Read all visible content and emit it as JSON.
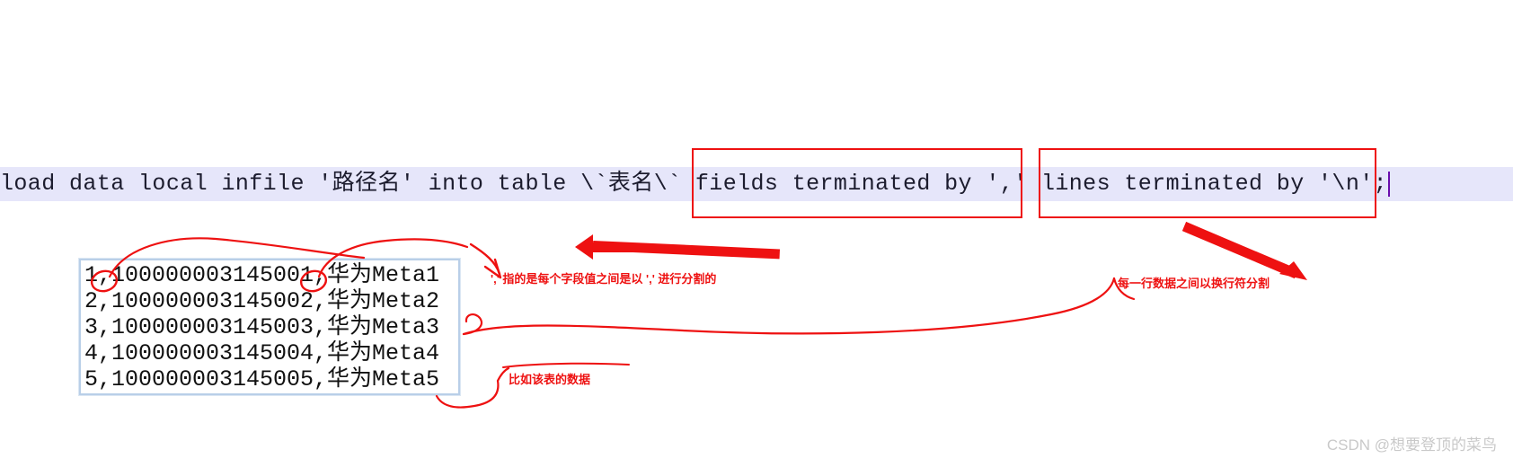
{
  "editor": {
    "sql_statement": "load data local infile '路径名' into table \\`表名\\` fields terminated by ',' lines terminated by '\\n';",
    "highlight_color": "#e6e6fa",
    "caret_color": "#6a0dad"
  },
  "highlight_boxes": [
    {
      "name": "fields-clause-box",
      "clause": "fields terminated by ','"
    },
    {
      "name": "lines-clause-box",
      "clause": "lines terminated by '\\n';"
    }
  ],
  "data_block": {
    "border_color": "#b9cfe8",
    "rows": [
      "1,100000003145001,华为Meta1",
      "2,100000003145002,华为Meta2",
      "3,100000003145003,华为Meta3",
      "4,100000003145004,华为Meta4",
      "5,100000003145005,华为Meta5"
    ]
  },
  "annotations": {
    "accent_color": "#ee1111",
    "comma_note": "',' 指的是每个字段值之间是以 ',' 进行分割的",
    "newline_note": "每一行数据之间以换行符分割",
    "sample_note": "比如该表的数据"
  },
  "watermark": {
    "text": "CSDN @想要登顶的菜鸟"
  }
}
